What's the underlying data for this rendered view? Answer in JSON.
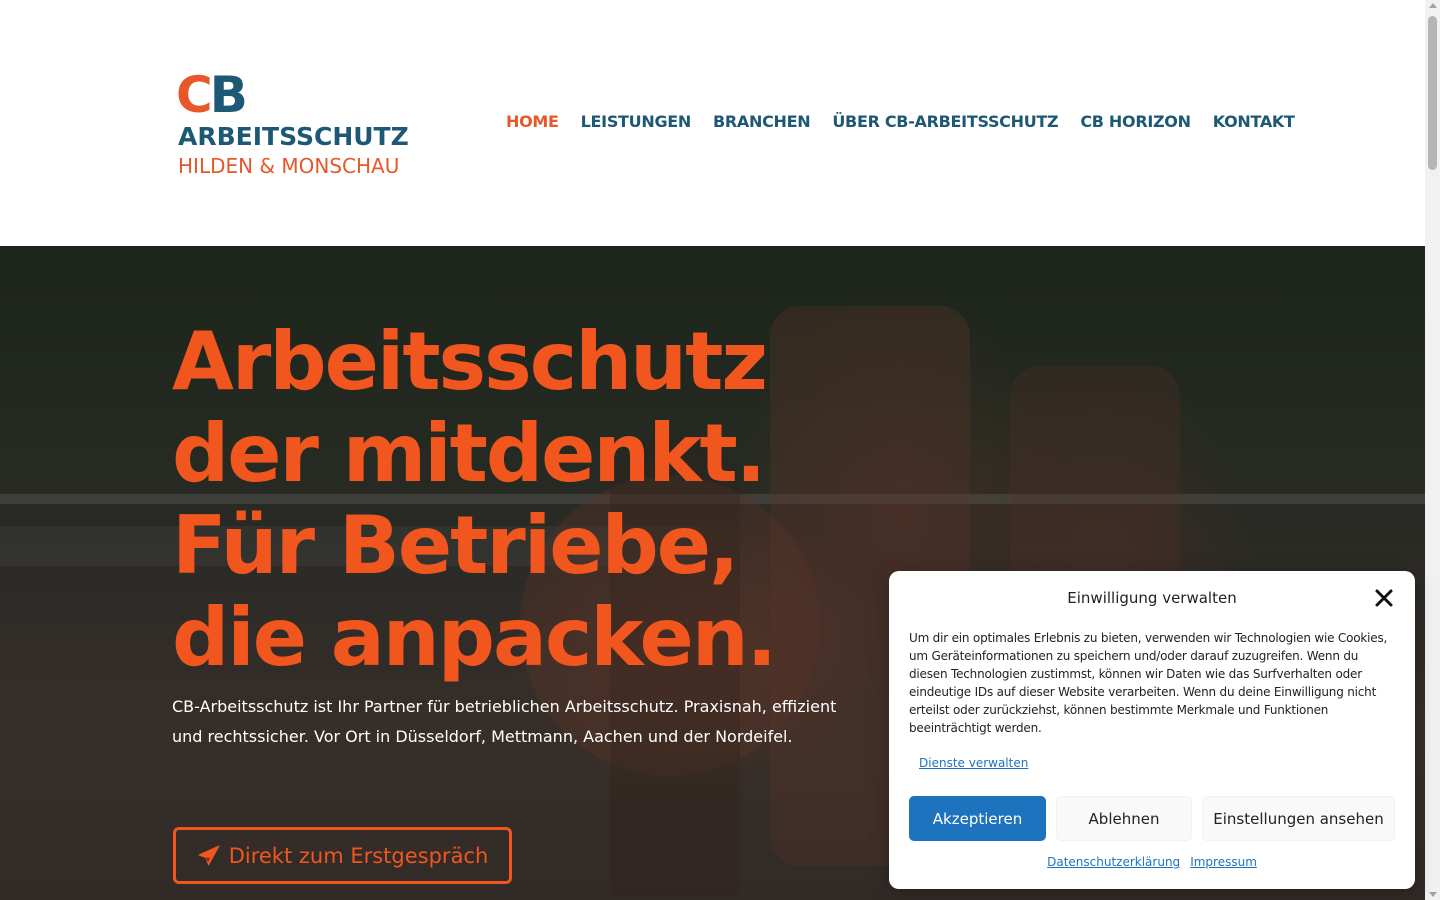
{
  "logo": {
    "c": "C",
    "b": "B",
    "line1": "ARBEITSSCHUTZ",
    "line2": "HILDEN & MONSCHAU"
  },
  "nav": {
    "items": [
      {
        "label": "HOME",
        "active": true
      },
      {
        "label": "LEISTUNGEN"
      },
      {
        "label": "BRANCHEN"
      },
      {
        "label": "ÜBER CB-ARBEITSSCHUTZ"
      },
      {
        "label": "CB HORIZON"
      },
      {
        "label": "KONTAKT"
      }
    ]
  },
  "hero": {
    "title_lines": [
      "Arbeitsschutz",
      "der mitdenkt.",
      "Für Betriebe,",
      "die anpacken."
    ],
    "text": "CB-Arbeitsschutz ist Ihr Partner für betrieblichen Arbeitsschutz. Praxisnah, effizient und rechtssicher. Vor Ort in Düsseldorf, Mettmann, Aachen und der Nordeifel.",
    "cta_label": "Direkt zum Erstgespräch",
    "cta_icon": "paper-plane-icon"
  },
  "consent": {
    "title": "Einwilligung verwalten",
    "text": "Um dir ein optimales Erlebnis zu bieten, verwenden wir Technologien wie Cookies, um Geräteinformationen zu speichern und/oder darauf zuzugreifen. Wenn du diesen Technologien zustimmst, können wir Daten wie das Surfverhalten oder eindeutige IDs auf dieser Website verarbeiten. Wenn du deine Einwilligung nicht erteilst oder zurückziehst, können bestimmte Merkmale und Funktionen beeinträchtigt werden.",
    "manage_label": "Dienste verwalten",
    "accept_label": "Akzeptieren",
    "deny_label": "Ablehnen",
    "settings_label": "Einstellungen ansehen",
    "privacy_link": "Datenschutzerklärung",
    "imprint_link": "Impressum"
  },
  "colors": {
    "brand_orange": "#f0561e",
    "brand_blue": "#1d5874",
    "accept_blue": "#1e73be"
  }
}
